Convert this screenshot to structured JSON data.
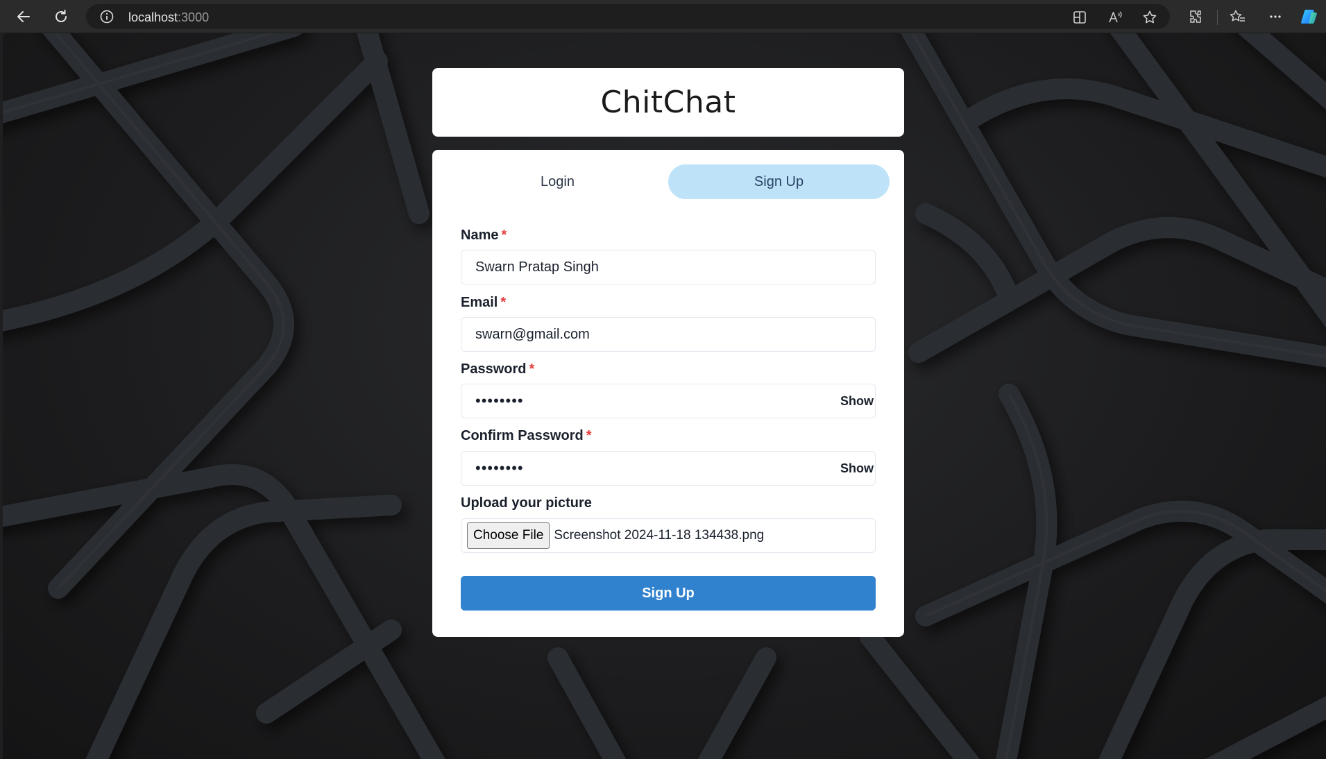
{
  "browser": {
    "url_host": "localhost",
    "url_port": ":3000"
  },
  "app": {
    "title": "ChitChat"
  },
  "tabs": [
    {
      "label": "Login"
    },
    {
      "label": "Sign Up",
      "active": true
    }
  ],
  "form": {
    "name": {
      "label": "Name",
      "required_mark": "*",
      "value": "Swarn Pratap Singh"
    },
    "email": {
      "label": "Email",
      "required_mark": "*",
      "value": "swarn@gmail.com"
    },
    "password": {
      "label": "Password",
      "required_mark": "*",
      "value": "••••••••",
      "toggle_label": "Show"
    },
    "confirm_password": {
      "label": "Confirm Password",
      "required_mark": "*",
      "value": "••••••••",
      "toggle_label": "Show"
    },
    "picture": {
      "label": "Upload your picture",
      "button_label": "Choose File",
      "file_name": "Screenshot 2024-11-18 134438.png"
    },
    "submit_label": "Sign Up"
  },
  "colors": {
    "active_tab_bg": "#bee3f8",
    "submit_bg": "#3182ce",
    "required": "#e53e3e"
  },
  "icons": [
    "back-icon",
    "refresh-icon",
    "info-icon",
    "split-screen-icon",
    "read-aloud-icon",
    "favorite-star-icon",
    "extensions-icon",
    "favorites-icon",
    "more-icon",
    "copilot-icon"
  ]
}
